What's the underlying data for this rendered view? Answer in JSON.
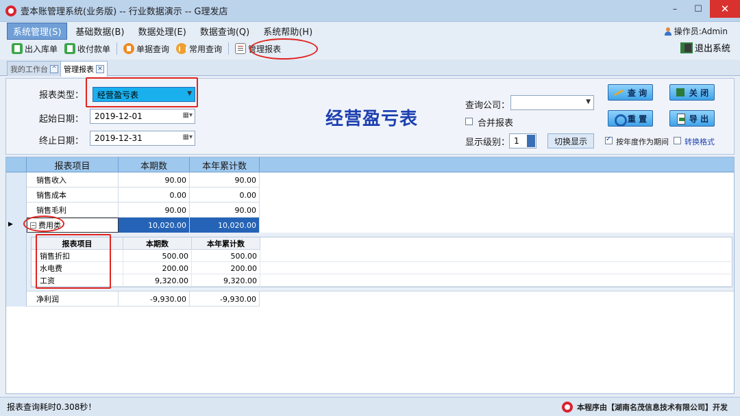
{
  "window": {
    "title": "壹本账管理系统(业务版) -- 行业数据演示 -- G理发店",
    "minimize": "–",
    "maximize": "☐",
    "close": "✕"
  },
  "menu": {
    "items": [
      "系统管理(S)",
      "基础数据(B)",
      "数据处理(E)",
      "数据查询(Q)",
      "系统帮助(H)"
    ],
    "operator": "操作员:Admin"
  },
  "toolbar": {
    "stock": "出入库单",
    "payment": "收付款单",
    "doc_query": "单据查询",
    "common_query": "常用查询",
    "mgmt_report": "管理报表",
    "exit": "退出系统"
  },
  "tabs": [
    {
      "label": "我的工作台",
      "icon": "^"
    },
    {
      "label": "管理报表",
      "icon": "✕"
    }
  ],
  "filters": {
    "report_type_label": "报表类型：",
    "report_type_value": "经营盈亏表",
    "start_label": "起始日期：",
    "start_value": "2019-12-01",
    "end_label": "终止日期：",
    "end_value": "2019-12-31",
    "report_title": "经营盈亏表",
    "company_label": "查询公司：",
    "company_value": "",
    "merge_label": "合并报表",
    "level_label": "显示级别：",
    "level_value": "1",
    "toggle_label": "切换显示",
    "fiscal_year_label": "按年度作为期间",
    "convert_label": "转换格式"
  },
  "actions": {
    "query": "查 询",
    "close": "关 闭",
    "reset": "重 置",
    "export": "导 出"
  },
  "grid": {
    "columns": [
      "报表项目",
      "本期数",
      "本年累计数"
    ],
    "rows": [
      {
        "item": "销售收入",
        "period": "90.00",
        "ytd": "90.00"
      },
      {
        "item": "销售成本",
        "period": "0.00",
        "ytd": "0.00"
      },
      {
        "item": "销售毛利",
        "period": "90.00",
        "ytd": "90.00"
      },
      {
        "item": "费用类",
        "period": "10,020.00",
        "ytd": "10,020.00"
      },
      {
        "item": "净利润",
        "period": "-9,930.00",
        "ytd": "-9,930.00"
      }
    ],
    "expander": "−",
    "detail_columns": [
      "报表项目",
      "本期数",
      "本年累计数"
    ],
    "detail_rows": [
      {
        "item": "销售折扣",
        "period": "500.00",
        "ytd": "500.00"
      },
      {
        "item": "水电费",
        "period": "200.00",
        "ytd": "200.00"
      },
      {
        "item": "工资",
        "period": "9,320.00",
        "ytd": "9,320.00"
      }
    ]
  },
  "status": {
    "text": "报表查询耗时0.308秒！",
    "credit": "本程序由【湖南名茂信息技术有限公司】开发"
  }
}
